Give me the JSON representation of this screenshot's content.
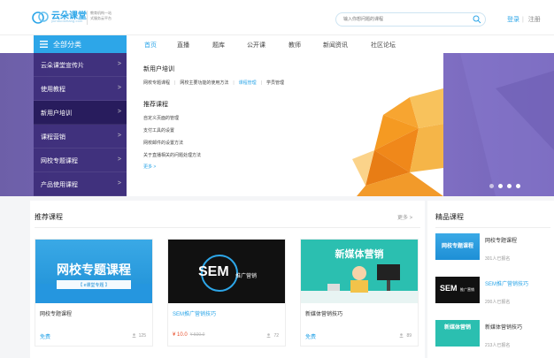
{
  "header": {
    "logo_text": "云朵课堂",
    "logo_sub": "yunduoketang.com",
    "logo_slogan_1": "教育机构一站",
    "logo_slogan_2": "式服务云平台",
    "search_placeholder": "输入你想问题的课程",
    "login": "登录",
    "separator": "|",
    "register": "注册"
  },
  "nav": {
    "all_categories": "全部分类",
    "items": [
      {
        "label": "首页",
        "active": true
      },
      {
        "label": "直播"
      },
      {
        "label": "题库"
      },
      {
        "label": "公开课"
      },
      {
        "label": "教师"
      },
      {
        "label": "新闻资讯"
      },
      {
        "label": "社区论坛"
      }
    ]
  },
  "sidebar": {
    "items": [
      {
        "label": "云朵课堂宣传片"
      },
      {
        "label": "使用教程"
      },
      {
        "label": "新用户培训"
      },
      {
        "label": "课程营销"
      },
      {
        "label": "网校专题课程"
      },
      {
        "label": "产品使用课程"
      }
    ],
    "arrow": ">"
  },
  "dropdown": {
    "title_training": "新用户培训",
    "links": [
      "网校专题课程",
      "网校主要功能的使用方法",
      "课程管理",
      "学员管理"
    ],
    "title_recommend": "推荐课程",
    "rec_items": [
      "自定义页面的管理",
      "支付工具的设置",
      "网校邮件的设置方法",
      "关于直播相关的问题处理方法"
    ],
    "more": "更多 >"
  },
  "main": {
    "section_title": "推荐课程",
    "more": "更多 >",
    "cards": [
      {
        "title": "网校专题课程",
        "price": "免费",
        "count": "125",
        "banner_text": "网校专题课程",
        "banner_sub": "【 e课堂专题 】"
      },
      {
        "title": "SEM推广营销技巧",
        "price": "¥ 10.0",
        "old_price": "¥ 500.0",
        "count": "72",
        "banner_text": "SEM",
        "banner_sub": "推广营销"
      },
      {
        "title": "新媒体营销技巧",
        "price": "免费",
        "count": "89",
        "banner_text": "新媒体营销"
      }
    ]
  },
  "side": {
    "title": "精品课程",
    "items": [
      {
        "name": "网校专题课程",
        "count": "301人已报名"
      },
      {
        "name": "SEM推广营销技巧",
        "count": "200人已报名"
      },
      {
        "name": "新媒体营销技巧",
        "count": "213人已报名"
      }
    ]
  },
  "colors": {
    "accent": "#2da6e8",
    "banner": "#7a6bbf",
    "price_red": "#e8502d"
  }
}
